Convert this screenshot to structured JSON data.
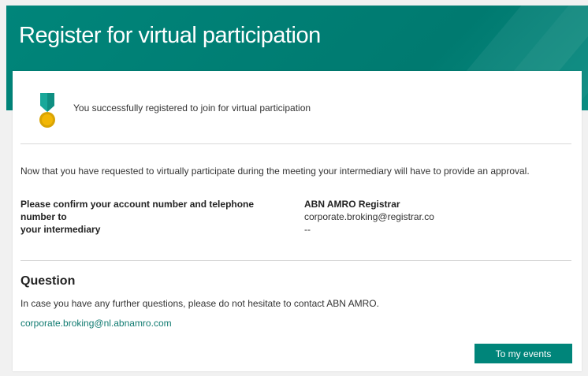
{
  "header": {
    "title": "Register for virtual participation"
  },
  "success": {
    "icon": "medal-icon",
    "message": "You successfully registered to join for virtual participation"
  },
  "intro": {
    "text": "Now that you have requested to virtually participate during the meeting your intermediary will have to provide an approval."
  },
  "confirm": {
    "line1": "Please confirm your account number and telephone number to",
    "line2": "your intermediary"
  },
  "registrar": {
    "name": "ABN AMRO Registrar",
    "email": "corporate.broking@registrar.co",
    "phone": "--"
  },
  "question": {
    "title": "Question",
    "text": "In case you have any further questions, please do not hesitate to contact ABN AMRO.",
    "email": "corporate.broking@nl.abnamro.com"
  },
  "actions": {
    "my_events_label": "To my events"
  },
  "colors": {
    "brand": "#00857a",
    "medal_ribbon": "#19a89a",
    "medal_coin": "#f2b705"
  }
}
